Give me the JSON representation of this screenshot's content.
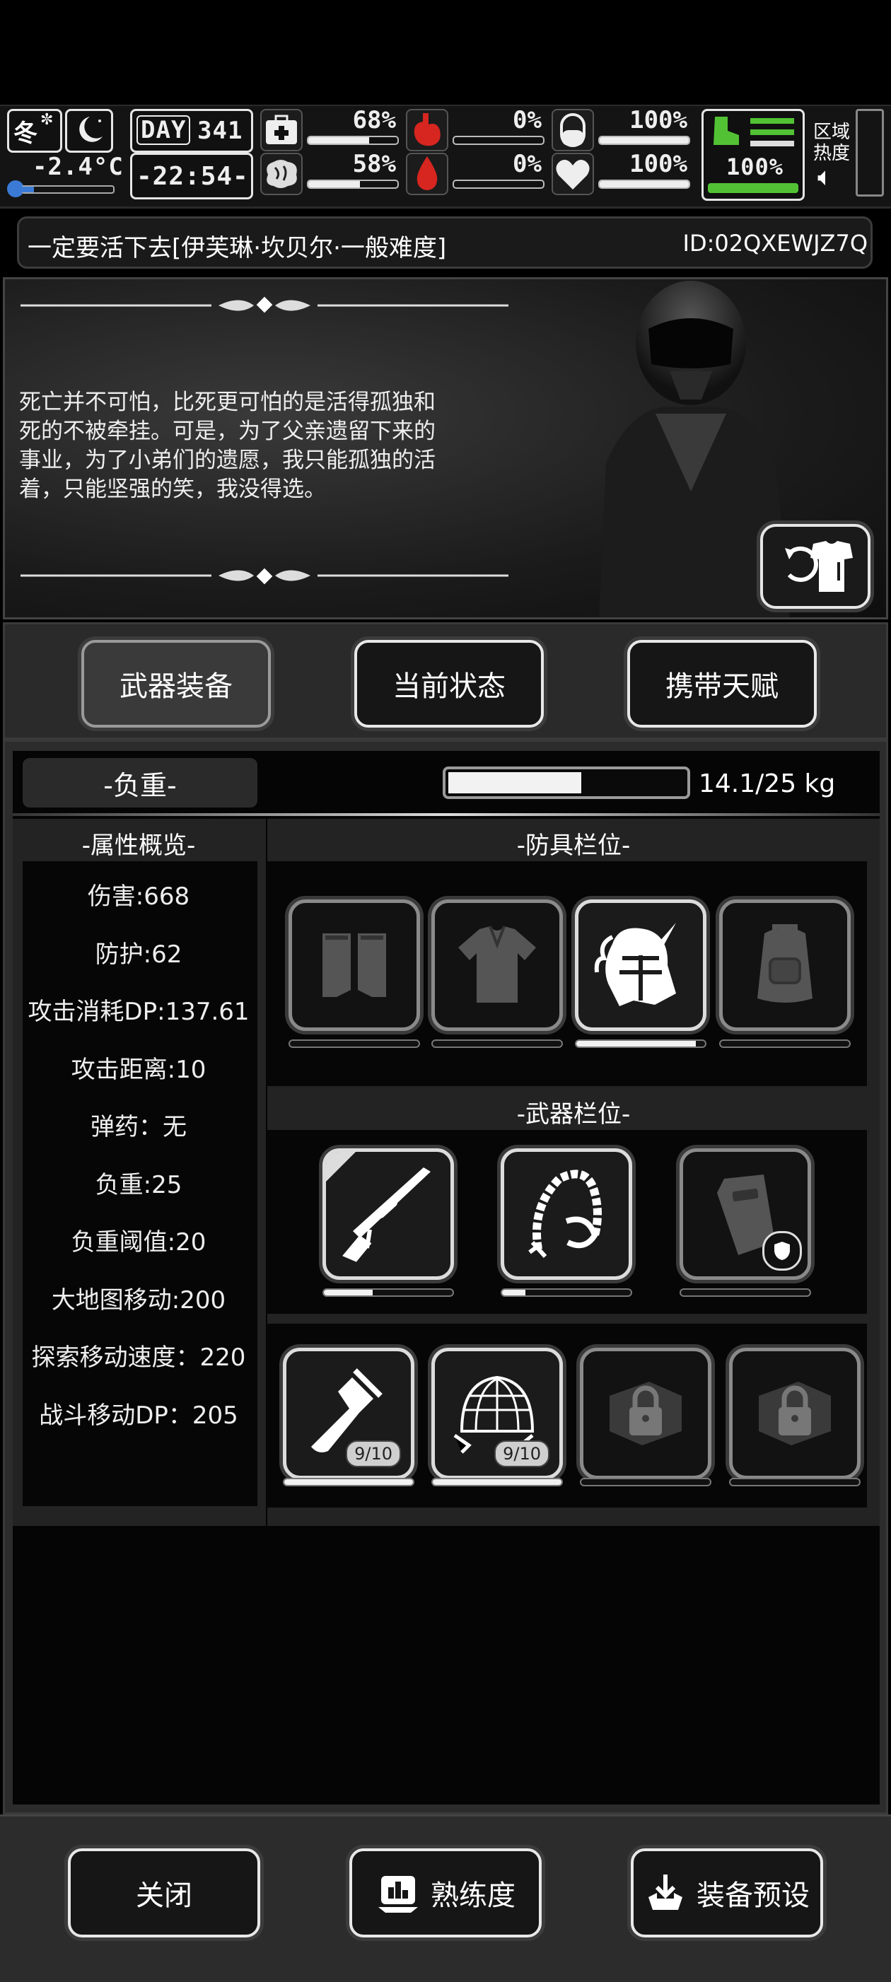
{
  "status_bar": {
    "season": "冬",
    "temperature": "-2.4°C",
    "day_label": "DAY",
    "day_number": "341",
    "time": "-22:54-",
    "stats": [
      {
        "icon": "medkit-icon",
        "value": "68%",
        "fill": 0.68
      },
      {
        "icon": "stomach-icon",
        "value": "0%",
        "fill": 0.0
      },
      {
        "icon": "capsule-icon",
        "value": "100%",
        "fill": 1.0
      },
      {
        "icon": "brain-icon",
        "value": "58%",
        "fill": 0.58
      },
      {
        "icon": "blood-drop-icon",
        "value": "0%",
        "fill": 0.0
      },
      {
        "icon": "heart-icon",
        "value": "100%",
        "fill": 1.0
      }
    ],
    "stamina_value": "100%",
    "stamina_fill": 1.0,
    "zone_heat_label_1": "区域",
    "zone_heat_label_2": "热度",
    "accent_green": "#52c234",
    "accent_red": "#d6261f"
  },
  "title_bar": {
    "title": "一定要活下去[伊芙琳·坎贝尔·一般难度]",
    "id": "ID:02QXEWJZ7Q"
  },
  "story": {
    "lines": [
      "死亡并不可怕，比死更可怕的是活得孤独和",
      "死的不被牵挂。可是，为了父亲遗留下来的",
      "事业，为了小弟们的遗愿，我只能孤独的活",
      "着，只能坚强的笑，我没得选。"
    ],
    "outfit_button_icon": "outfit-swap-icon"
  },
  "tabs": [
    {
      "label": "武器装备",
      "active": true
    },
    {
      "label": "当前状态",
      "active": false
    },
    {
      "label": "携带天赋",
      "active": false
    }
  ],
  "load": {
    "label": "-负重-",
    "value": "14.1/25 kg",
    "fill": 0.564
  },
  "attributes": {
    "header": "-属性概览-",
    "items": [
      "伤害:668",
      "防护:62",
      "攻击消耗DP:137.61",
      "攻击距离:10",
      "弹药：无",
      "负重:25",
      "负重阈值:20",
      "大地图移动:200",
      "探索移动速度：220",
      "战斗移动DP：205"
    ]
  },
  "armor": {
    "header": "-防具栏位-",
    "slots": [
      {
        "icon": "gloves-icon",
        "empty": true,
        "fill": 0.0
      },
      {
        "icon": "shirt-icon",
        "empty": true,
        "fill": 0.0
      },
      {
        "icon": "unicorn-helmet-icon",
        "empty": false,
        "fill": 0.93
      },
      {
        "icon": "backpack-icon",
        "empty": true,
        "fill": 0.0
      }
    ]
  },
  "weapons": {
    "header": "-武器栏位-",
    "slots": [
      {
        "icon": "sniper-rifle-icon",
        "empty": false,
        "fill": 0.38
      },
      {
        "icon": "bone-whip-icon",
        "empty": false,
        "fill": 0.18
      },
      {
        "icon": "riot-shield-icon",
        "empty": true,
        "fill": 0.0
      }
    ]
  },
  "consumables": {
    "slots": [
      {
        "icon": "flashlight-icon",
        "qty": "9/10",
        "locked": false,
        "fill": 1.0
      },
      {
        "icon": "net-trap-icon",
        "qty": "9/10",
        "locked": false,
        "fill": 1.0
      },
      {
        "icon": "padlock-icon",
        "qty": "",
        "locked": true,
        "fill": 0.0
      },
      {
        "icon": "padlock-icon",
        "qty": "",
        "locked": true,
        "fill": 0.0
      }
    ]
  },
  "bottom_buttons": {
    "close": "关闭",
    "proficiency": "熟练度",
    "preset": "装备预设"
  }
}
